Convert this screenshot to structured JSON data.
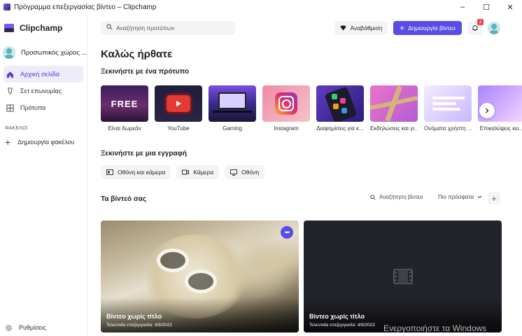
{
  "window": {
    "title": "Πρόγραμμα επεξεργασίας βίντεο – Clipchamp",
    "minimize": "–",
    "maximize": "☐",
    "close": "✕"
  },
  "sidebar": {
    "brand": "Clipchamp",
    "workspace": "Προσωπικός χώρος ...",
    "items": [
      {
        "label": "Αρχική σελίδα",
        "icon": "home-icon",
        "active": true
      },
      {
        "label": "Σετ επωνυμίας",
        "icon": "brand-kit-icon",
        "active": false
      },
      {
        "label": "Πρότυπα",
        "icon": "templates-icon",
        "active": false
      }
    ],
    "folders_label": "ΦΑΚΕΛΟΙ",
    "create_folder": "Δημιουργία φακέλου",
    "settings": "Ρυθμίσεις"
  },
  "header": {
    "search_placeholder": "Αναζήτηση προτύπων",
    "upgrade": "Αναβάθμιση",
    "create_video": "Δημιουργία βίντεο",
    "notification_count": "2"
  },
  "main": {
    "welcome": "Καλώς ήρθατε",
    "templates_heading": "Ξεκινήστε με ένα πρότυπο",
    "templates": [
      {
        "label": "Είναι δωρεάν",
        "thumb_text": "FREE"
      },
      {
        "label": "YouTube"
      },
      {
        "label": "Gaming"
      },
      {
        "label": "Instagram"
      },
      {
        "label": "Διαφημίσεις για κ..."
      },
      {
        "label": "Εκδηλώσεις και γι..."
      },
      {
        "label": "Ονόματα χρήστη ..."
      },
      {
        "label": "Επικαλύψεις κει..."
      }
    ],
    "record_heading": "Ξεκινήστε με μια εγγραφή",
    "record_options": [
      {
        "label": "Οθόνη και κάμερα"
      },
      {
        "label": "Κάμερα"
      },
      {
        "label": "Οθόνη"
      }
    ],
    "videos_heading": "Τα βίντεό σας",
    "videos_search": "Αναζήτηση βίντεο",
    "videos_sort": "Πιο πρόσφατα",
    "videos": [
      {
        "title": "Βίντεο χωρίς τίτλο",
        "meta": "Τελευταία επεξεργασία: 4/9/2022"
      },
      {
        "title": "Βίντεο χωρίς τίτλο",
        "meta": "Τελευταία επεξεργασία: 4/9/2022"
      }
    ]
  },
  "watermark": "Ενεργοποιήστε τα Windows",
  "colors": {
    "accent": "#5b4ce6",
    "active_nav_bg": "#eeecfb",
    "badge": "#e5484d"
  }
}
